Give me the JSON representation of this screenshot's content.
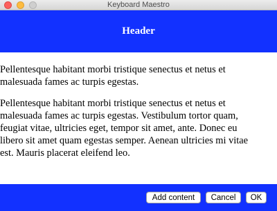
{
  "window": {
    "title": "Keyboard Maestro"
  },
  "header": {
    "title": "Header"
  },
  "content": {
    "paragraphs": [
      {
        "lines": [
          "Pellentesque habitant morbi tristique senectus et netus et",
          "malesuada fames ac turpis egestas."
        ]
      },
      {
        "lines": [
          "Pellentesque habitant morbi tristique senectus et netus et",
          "malesuada fames ac turpis egestas. Vestibulum tortor quam,",
          "feugiat vitae, ultricies eget, tempor sit amet, ante. Donec eu",
          "libero sit amet quam egestas semper. Aenean ultricies mi vitae",
          "est. Mauris placerat eleifend leo."
        ]
      }
    ]
  },
  "footer": {
    "add_content_label": "Add content",
    "cancel_label": "Cancel",
    "ok_label": "OK"
  },
  "colors": {
    "header_bg": "#1231ff",
    "footer_bg": "#1231ff",
    "close": "#fc605c",
    "minimize": "#fdbc40",
    "zoom_disabled": "#cfcfcf"
  }
}
